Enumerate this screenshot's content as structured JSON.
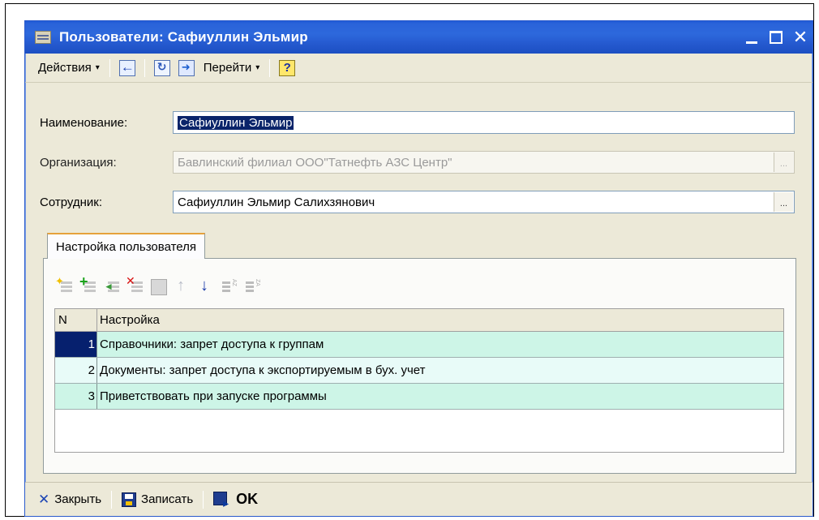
{
  "window": {
    "title": "Пользователи: Сафиуллин Эльмир",
    "minimize_glyph": "_",
    "maximize_glyph": "□",
    "close_glyph": "✕"
  },
  "toolbar": {
    "actions_label": "Действия",
    "goto_label": "Перейти",
    "dropdown_glyph": "▾",
    "help_glyph": "?"
  },
  "form": {
    "name_label": "Наименование:",
    "name_value": "Сафиуллин Эльмир",
    "org_label": "Организация:",
    "org_value": "Бавлинский филиал ООО\"Татнефть АЗС Центр\"",
    "employee_label": "Сотрудник:",
    "employee_value": "Сафиуллин Эльмир Салихзянович",
    "select_button_glyph": "..."
  },
  "tab": {
    "label": "Настройка пользователя"
  },
  "table": {
    "columns": [
      "N",
      "Настройка"
    ],
    "rows": [
      {
        "n": "1",
        "name": "Справочники: запрет доступа к группам"
      },
      {
        "n": "2",
        "name": "Документы: запрет доступа к экспортируемым в бух. учет"
      },
      {
        "n": "3",
        "name": "Приветствовать при запуске программы"
      }
    ]
  },
  "bottom": {
    "close_label": "Закрыть",
    "close_glyph": "✕",
    "save_label": "Записать",
    "ok_label": "OK"
  }
}
